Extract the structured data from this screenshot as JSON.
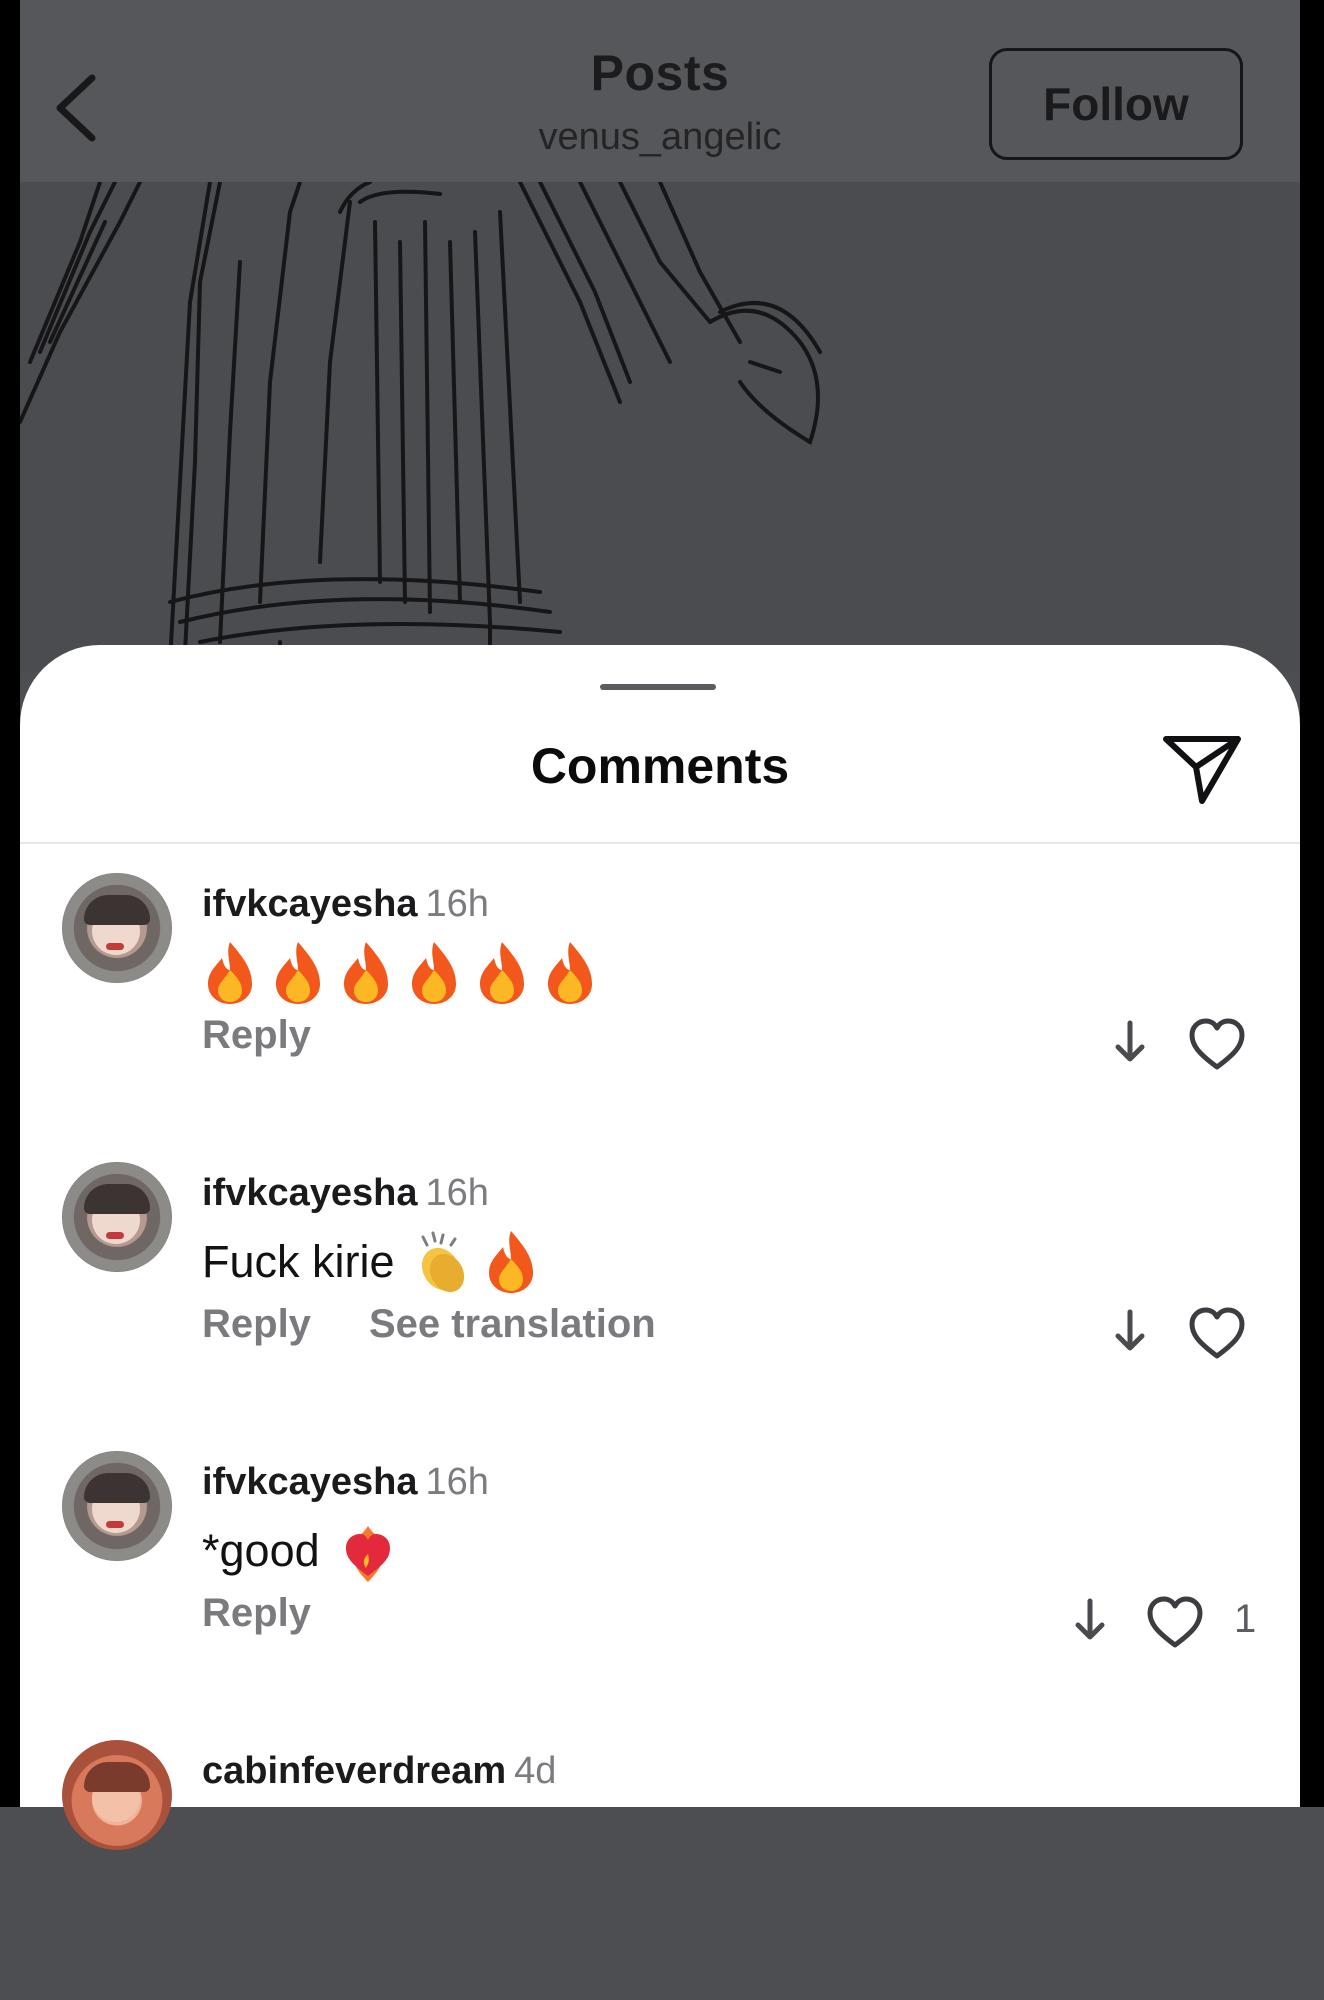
{
  "header": {
    "title": "Posts",
    "username": "venus_angelic",
    "follow_label": "Follow"
  },
  "comments_sheet": {
    "title": "Comments"
  },
  "comments": [
    {
      "username": "ifvkcayesha",
      "time": "16h",
      "text": "",
      "emojis": [
        "fire",
        "fire",
        "fire",
        "fire",
        "fire",
        "fire"
      ],
      "reply_label": "Reply",
      "translate_label": "",
      "likes": ""
    },
    {
      "username": "ifvkcayesha",
      "time": "16h",
      "text": "Fuck kirie",
      "emojis": [
        "clapping-hands",
        "fire"
      ],
      "reply_label": "Reply",
      "translate_label": "See translation",
      "likes": ""
    },
    {
      "username": "ifvkcayesha",
      "time": "16h",
      "text": "*good",
      "emojis": [
        "heart-on-fire"
      ],
      "reply_label": "Reply",
      "translate_label": "",
      "likes": "1"
    },
    {
      "username": "cabinfeverdream",
      "time": "4d",
      "text": "",
      "emojis": [],
      "reply_label": "",
      "translate_label": "",
      "likes": ""
    }
  ],
  "icons": {
    "back": "chevron-left-icon",
    "share": "paper-plane-icon",
    "sort": "arrow-down-icon",
    "like": "heart-outline-icon"
  },
  "colors": {
    "overlay_gray": "#4d4e52",
    "sheet_bg": "#ffffff",
    "username": "#1b1b1d",
    "secondary_text": "#7a7a7f"
  }
}
